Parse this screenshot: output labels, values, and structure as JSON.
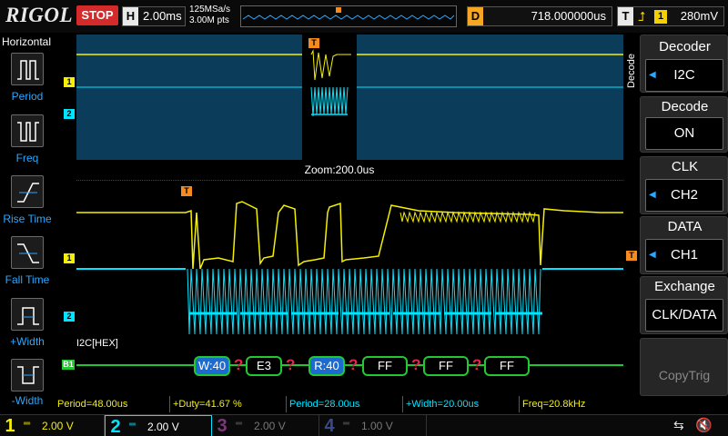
{
  "header": {
    "brand": "RIGOL",
    "run_state": "STOP",
    "timebase_letter": "H",
    "timebase": "2.00ms",
    "sample_rate": "125MSa/s",
    "memory_depth": "3.00M pts",
    "delay_letter": "D",
    "delay": "718.000000us",
    "trigger_letter": "T",
    "trigger_source": "1",
    "trigger_level": "280mV"
  },
  "left_menu": {
    "title": "Horizontal",
    "items": [
      {
        "label": "Period"
      },
      {
        "label": "Freq"
      },
      {
        "label": "Rise Time"
      },
      {
        "label": "Fall Time"
      },
      {
        "label": "+Width"
      },
      {
        "label": "-Width"
      }
    ]
  },
  "screen": {
    "zoom_label": "Zoom:200.0us",
    "bus_label": "I2C[HEX]",
    "channel_markers": {
      "ch1": "1",
      "ch2": "2",
      "bus": "B1",
      "trigger": "T"
    },
    "packets": [
      {
        "text": "W:40",
        "highlight": true
      },
      {
        "text": "E3",
        "highlight": false
      },
      {
        "text": "R:40",
        "highlight": true
      },
      {
        "text": "FF",
        "highlight": false
      },
      {
        "text": "FF",
        "highlight": false
      },
      {
        "text": "FF",
        "highlight": false
      }
    ],
    "error_mark": "?"
  },
  "measurements": [
    {
      "text": "Period=48.00us",
      "color": "#f5f000"
    },
    {
      "text": "+Duty=41.67 %",
      "color": "#f5f000"
    },
    {
      "text": "Period=28.00us",
      "color": "#00e5ff"
    },
    {
      "text": "+Width=20.00us",
      "color": "#00e5ff"
    },
    {
      "text": "Freq=20.8kHz",
      "color": "#f5f000"
    }
  ],
  "right_menu": {
    "side_tab": "Decode",
    "title": "Decoder",
    "decoder": "I2C",
    "decode_label": "Decode",
    "decode_value": "ON",
    "clk_label": "CLK",
    "clk_value": "CH2",
    "data_label": "DATA",
    "data_value": "CH1",
    "exchange_label": "Exchange",
    "exchange_value": "CLK/DATA",
    "copytrig": "CopyTrig"
  },
  "bottom": {
    "channels": [
      {
        "num": "1",
        "scale": "2.00 V",
        "color": "#f5f000"
      },
      {
        "num": "2",
        "scale": "2.00 V",
        "color": "#00e5ff"
      },
      {
        "num": "3",
        "scale": "2.00 V",
        "color": "#c040c0"
      },
      {
        "num": "4",
        "scale": "1.00 V",
        "color": "#5a78ff"
      }
    ]
  },
  "colors": {
    "ch1": "#f5f000",
    "ch2": "#00e5ff",
    "bus": "#22c832",
    "trigger": "#f58a1f",
    "stop": "#d42a2a"
  }
}
